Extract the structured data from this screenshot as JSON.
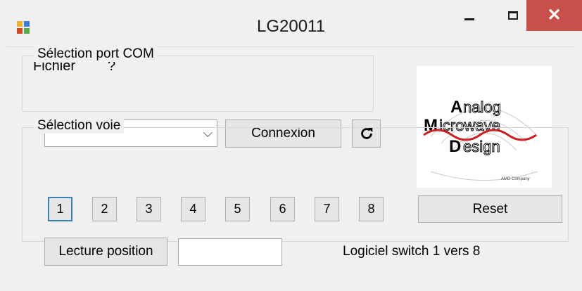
{
  "window": {
    "title": "LG20011",
    "close_glyph": "✕",
    "app_icon": "app-window-icon"
  },
  "menu": {
    "items": [
      "Fichier",
      "?"
    ]
  },
  "com_group": {
    "legend": "Sélection port COM",
    "combo_value": "",
    "connect_label": "Connexion",
    "refresh_icon": "refresh-icon"
  },
  "logo": {
    "text_line1": "Analog",
    "text_line2": "Microwave",
    "text_line3": "Design",
    "tagline": "AMD Company"
  },
  "voie_group": {
    "legend": "Sélection voie",
    "channels": [
      "1",
      "2",
      "3",
      "4",
      "5",
      "6",
      "7",
      "8"
    ],
    "selected_channel": "1",
    "reset_label": "Reset",
    "lecture_label": "Lecture position",
    "position_value": "",
    "info_text": "Logiciel switch 1 vers 8"
  },
  "colors": {
    "close_button": "#c7504a",
    "selected_border": "#3c7fb1",
    "logo_red": "#cc1f1f"
  }
}
